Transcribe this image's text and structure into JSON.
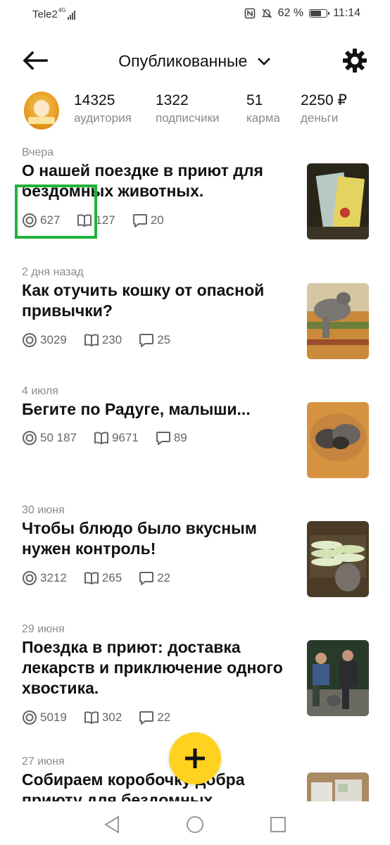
{
  "status_bar": {
    "carrier": "Tele2",
    "network": "4G",
    "battery_percent": "62 %",
    "time": "11:14",
    "icons": [
      "nfc-icon",
      "mute-bell-icon",
      "battery-icon"
    ]
  },
  "header": {
    "title": "Опубликованные",
    "back_icon": "arrow-left-icon",
    "dropdown_icon": "chevron-down-icon",
    "settings_icon": "gear-icon"
  },
  "stats": [
    {
      "value": "14325",
      "label": "аудитория"
    },
    {
      "value": "1322",
      "label": "подписчики"
    },
    {
      "value": "51",
      "label": "карма"
    },
    {
      "value": "2250 ₽",
      "label": "деньги"
    }
  ],
  "articles": [
    {
      "date": "Вчера",
      "title": "О нашей поездке в приют для бездомных животных.",
      "views": "627",
      "reads": "127",
      "comments": "20"
    },
    {
      "date": "2 дня назад",
      "title": "Как отучить кошку от опасной привычки?",
      "views": "3029",
      "reads": "230",
      "comments": "25"
    },
    {
      "date": "4 июля",
      "title": "Бегите по Радуге, малыши...",
      "views": "50 187",
      "reads": "9671",
      "comments": "89"
    },
    {
      "date": "30 июня",
      "title": "Чтобы блюдо было вкусным нужен контроль!",
      "views": "3212",
      "reads": "265",
      "comments": "22"
    },
    {
      "date": "29 июня",
      "title": "Поездка в приют: доставка лекарств и приключение одного хвостика.",
      "views": "5019",
      "reads": "302",
      "comments": "22"
    },
    {
      "date": "27 июня",
      "title": "Собираем коробочку добра приюту для бездомных",
      "views": "",
      "reads": "",
      "comments": ""
    }
  ],
  "fab": {
    "icon": "plus-icon"
  },
  "colors": {
    "accent_fab": "#ffd21f",
    "highlight": "#21b33b",
    "meta_text": "#666666",
    "date_text": "#8c8c8c"
  },
  "navbar": {
    "icons": [
      "nav-back-icon",
      "nav-home-icon",
      "nav-recents-icon"
    ]
  }
}
